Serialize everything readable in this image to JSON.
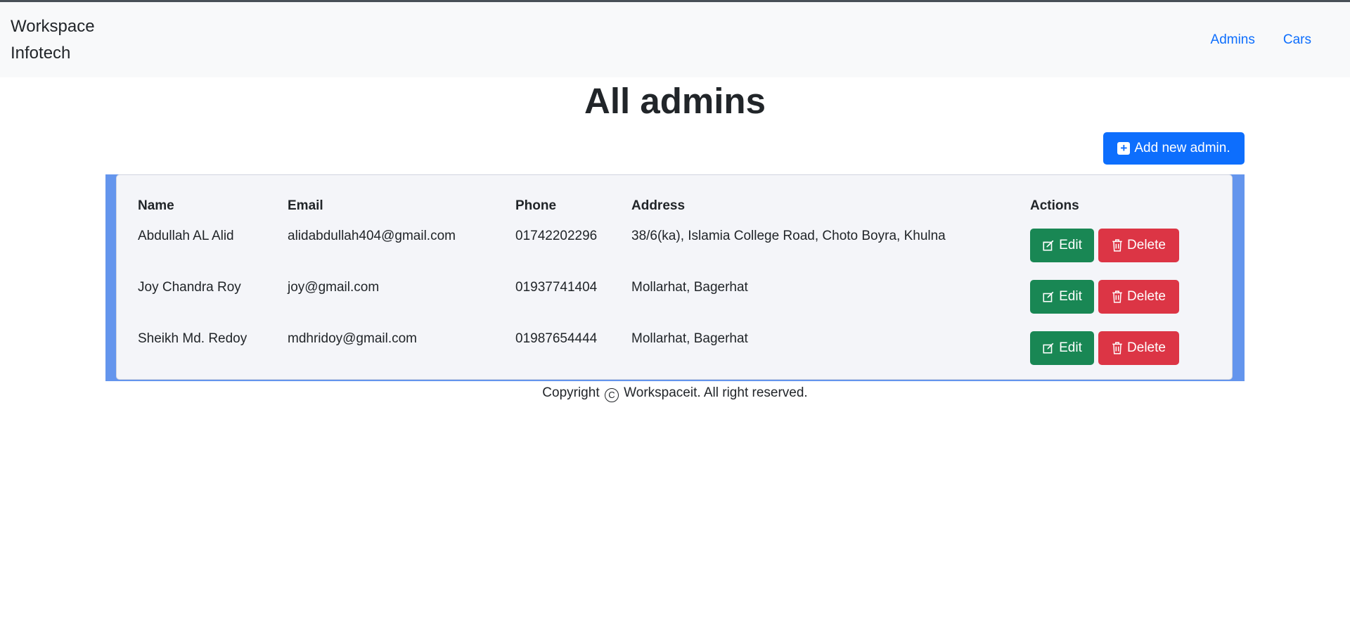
{
  "navbar": {
    "brand": "Workspace Infotech",
    "links": [
      "Admins",
      "Cars"
    ]
  },
  "page": {
    "title": "All admins",
    "add_button_label": "Add new admin."
  },
  "table": {
    "headers": [
      "Name",
      "Email",
      "Phone",
      "Address",
      "Actions"
    ],
    "rows": [
      {
        "name": "Abdullah AL Alid",
        "email": "alidabdullah404@gmail.com",
        "phone": "01742202296",
        "address": "38/6(ka), Islamia College Road, Choto Boyra, Khulna"
      },
      {
        "name": "Joy Chandra Roy",
        "email": "joy@gmail.com",
        "phone": "01937741404",
        "address": "Mollarhat, Bagerhat"
      },
      {
        "name": "Sheikh Md. Redoy",
        "email": "mdhridoy@gmail.com",
        "phone": "01987654444",
        "address": "Mollarhat, Bagerhat"
      }
    ],
    "edit_label": "Edit",
    "delete_label": "Delete"
  },
  "footer": {
    "before": "Copyright",
    "symbol": "C",
    "after": "Workspaceit. All right reserved."
  },
  "colors": {
    "primary": "#0d6efd",
    "success": "#198754",
    "danger": "#dc3545",
    "card_accent": "#6495ed"
  }
}
